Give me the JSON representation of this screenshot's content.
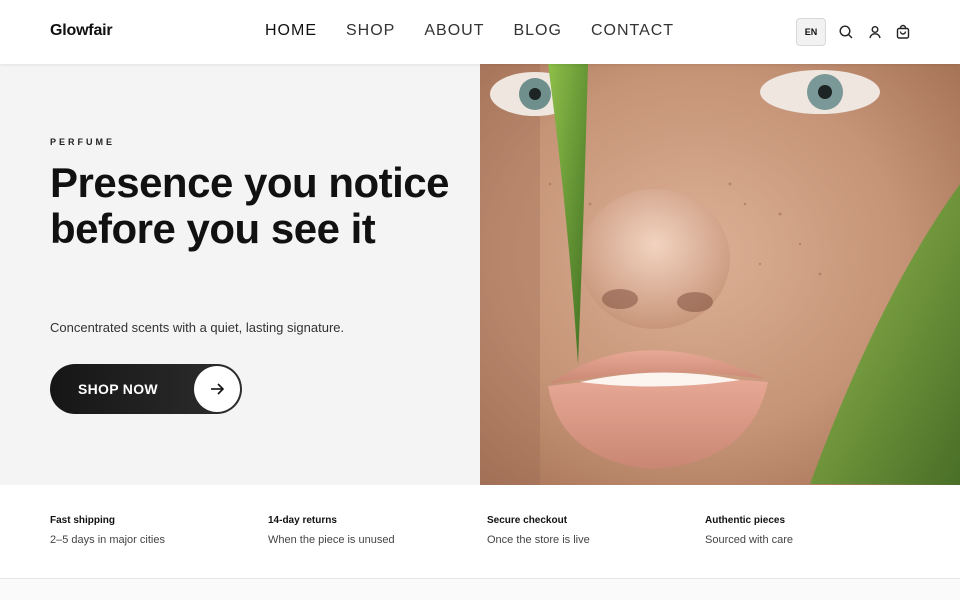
{
  "header": {
    "logo": "Glowfair",
    "nav": [
      {
        "label": "HOME",
        "active": true
      },
      {
        "label": "SHOP",
        "active": false
      },
      {
        "label": "ABOUT",
        "active": false
      },
      {
        "label": "BLOG",
        "active": false
      },
      {
        "label": "CONTACT",
        "active": false
      }
    ],
    "language": "EN",
    "icons": [
      "search-icon",
      "user-icon",
      "cart-icon"
    ]
  },
  "hero": {
    "eyebrow": "PERFUME",
    "headline": "Presence you notice before you see it",
    "subtitle": "Concentrated scents with a quiet, lasting signature.",
    "cta_label": "SHOP NOW",
    "cta_icon": "arrow-right-icon",
    "image": "close-up-face-with-green-leaf"
  },
  "features": [
    {
      "title": "Fast shipping",
      "desc": "2–5 days in major cities"
    },
    {
      "title": "14-day returns",
      "desc": "When the piece is unused"
    },
    {
      "title": "Secure checkout",
      "desc": "Once the store is live"
    },
    {
      "title": "Authentic pieces",
      "desc": "Sourced with care"
    }
  ],
  "colors": {
    "panel_bg": "#f4f4f4",
    "button_bg": "#161616",
    "text": "#111111"
  }
}
